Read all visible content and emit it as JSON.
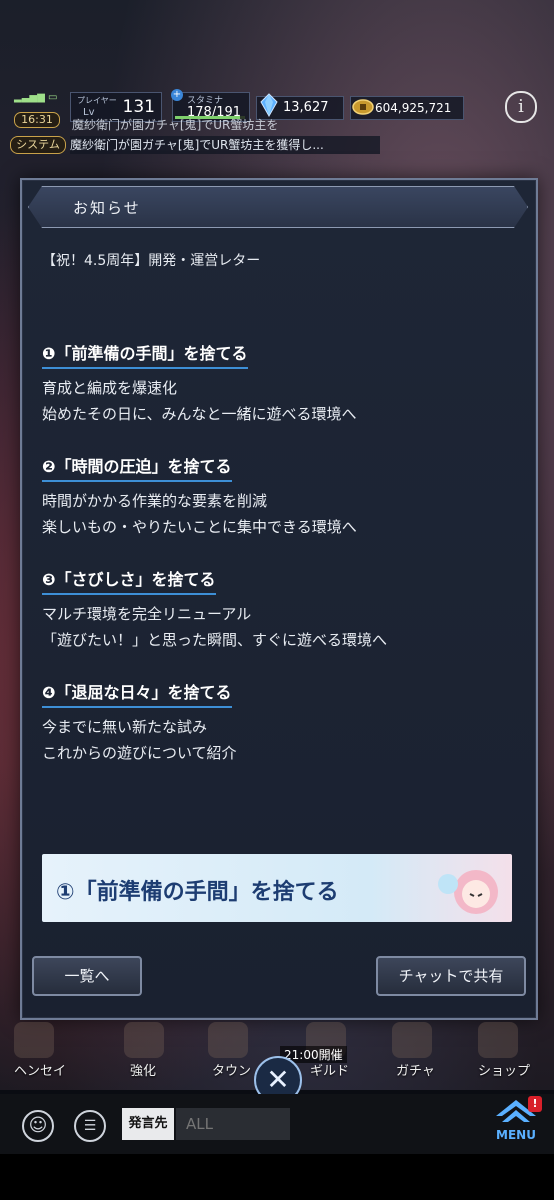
{
  "status": {
    "time": "16:31",
    "system_label": "システム"
  },
  "player": {
    "label": "プレイヤー",
    "lv_label": "Lv",
    "level": "131"
  },
  "stamina": {
    "label": "スタミナ",
    "value": "178/191",
    "fill": 0.93
  },
  "gems": {
    "value": "13,627",
    "icon": "crystal-icon"
  },
  "gold": {
    "value": "604,925,721",
    "icon": "coin-icon"
  },
  "info_icon": "i",
  "ticker": {
    "line1": "魔紗衛门が園ガチャ[鬼]でUR蟹坊主を",
    "line2": "魔紗衛门が園ガチャ[鬼]でUR蟹坊主を獲得し..."
  },
  "modal": {
    "title": "お知らせ",
    "subtitle": "【祝！4.5周年】開発・運営レター",
    "sections": [
      {
        "head": "❶「前準備の手間」を捨てる",
        "lines": [
          "育成と編成を爆速化",
          "始めたその日に、みんなと一緒に遊べる環境へ"
        ]
      },
      {
        "head": "❷「時間の圧迫」を捨てる",
        "lines": [
          "時間がかかる作業的な要素を削減",
          "楽しいもの・やりたいことに集中できる環境へ"
        ]
      },
      {
        "head": "❸「さびしさ」を捨てる",
        "lines": [
          "マルチ環境を完全リニューアル",
          "「遊びたい！」と思った瞬間、すぐに遊べる環境へ"
        ]
      },
      {
        "head": "❹「退屈な日々」を捨てる",
        "lines": [
          "今までに無い新たな試み",
          "これからの遊びについて紹介"
        ]
      }
    ],
    "banner_text": "①「前準備の手間」を捨てる",
    "back_button": "一覧へ",
    "share_button": "チャットで共有"
  },
  "bottom_nav": {
    "items": [
      "ヘンセイ",
      "強化",
      "タウン",
      "ギルド",
      "ガチャ",
      "ショップ"
    ],
    "event_tag": "21:00開催"
  },
  "chat": {
    "target_label": "発言先",
    "input_placeholder": "ALL",
    "menu_label": "MENU",
    "badge": "!"
  }
}
